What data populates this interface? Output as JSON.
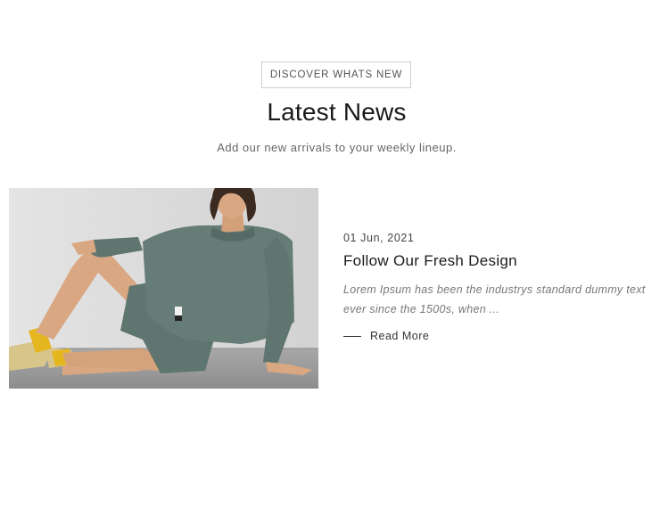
{
  "section": {
    "eyebrow": "DISCOVER WHATS NEW",
    "title": "Latest News",
    "subtitle": "Add our new arrivals to your weekly lineup."
  },
  "post": {
    "image_desc": "woman-in-green-sweatsuit-icon",
    "date": "01 Jun, 2021",
    "title": "Follow Our Fresh Design",
    "excerpt": "Lorem Ipsum has been the industrys standard dummy text ever since the 1500s, when ...",
    "read_more": "Read More"
  },
  "colors": {
    "outfit": "#5f756f",
    "socks": "#e5b620",
    "wall": "#dedede",
    "floor": "#9e9e9e"
  }
}
